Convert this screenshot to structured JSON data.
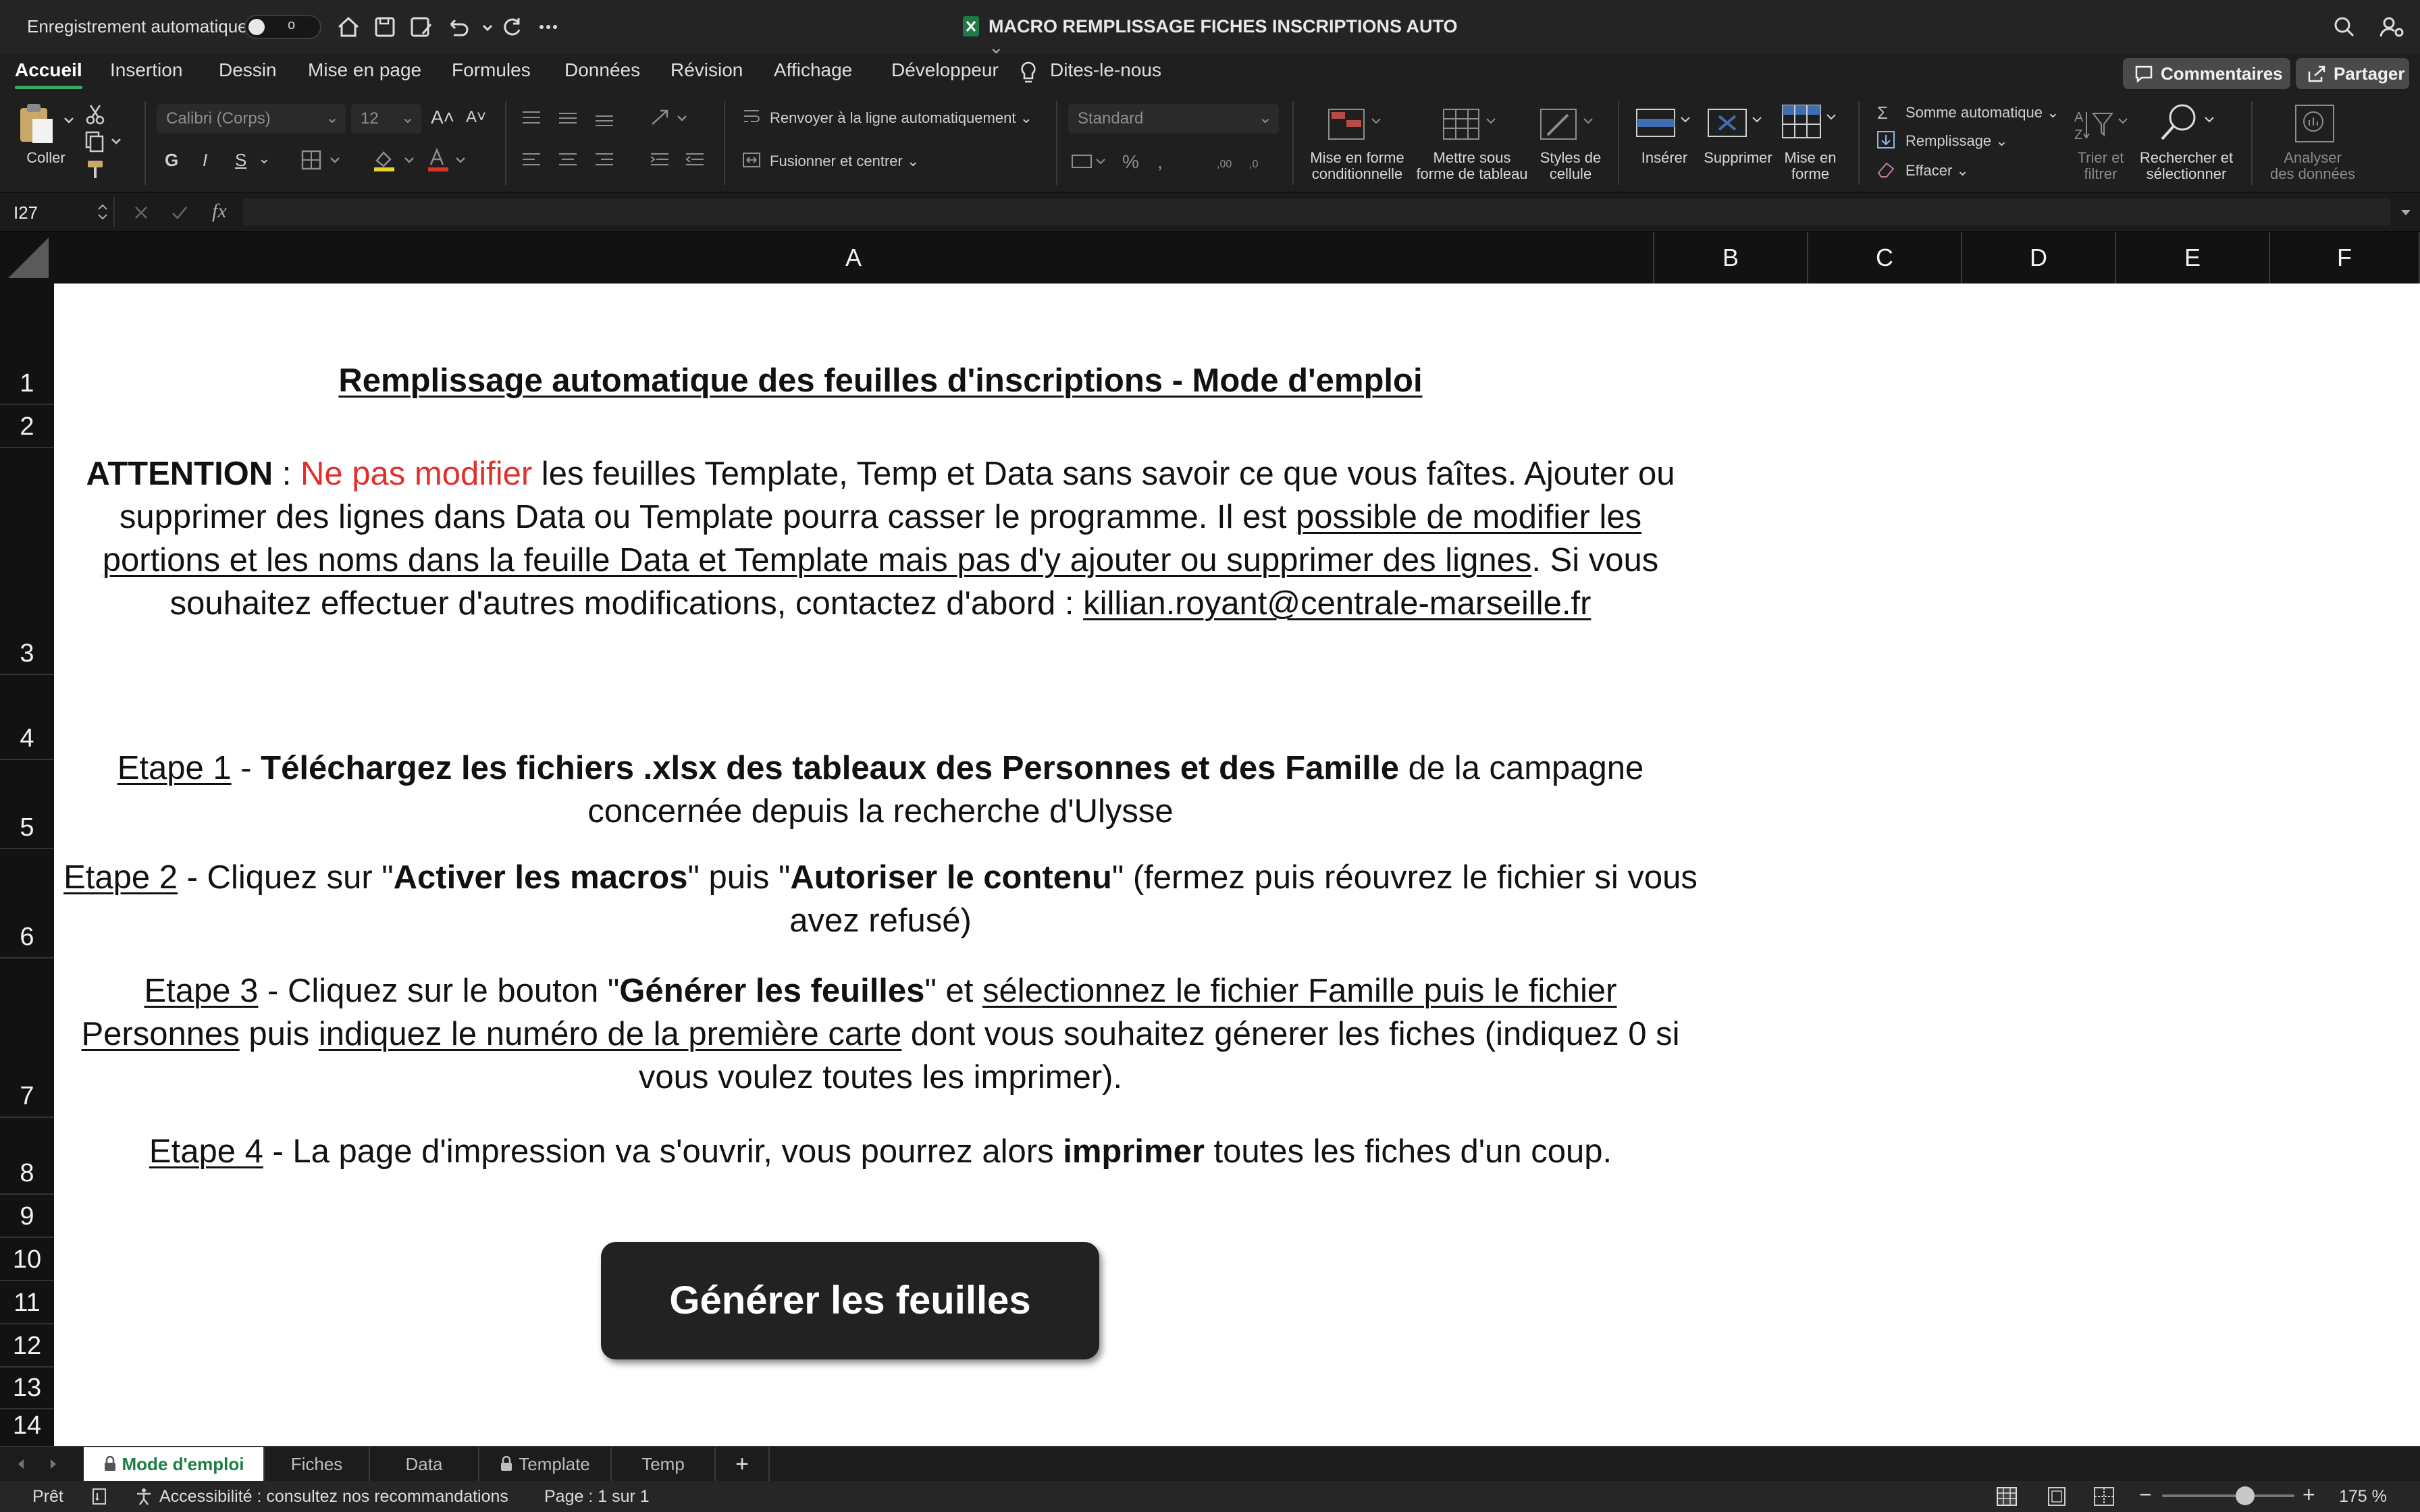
{
  "titlebar": {
    "autosave_label": "Enregistrement automatique",
    "autosave_state": "o",
    "document_title": "MACRO REMPLISSAGE FICHES INSCRIPTIONS AUTO"
  },
  "ribbon_tabs": [
    "Accueil",
    "Insertion",
    "Dessin",
    "Mise en page",
    "Formules",
    "Données",
    "Révision",
    "Affichage",
    "Développeur",
    "Dites-le-nous"
  ],
  "active_tab": "Accueil",
  "buttons": {
    "comments": "Commentaires",
    "share": "Partager"
  },
  "ribbon": {
    "paste": "Coller",
    "font_name": "Calibri (Corps)",
    "font_size": "12",
    "bold": "G",
    "italic": "I",
    "underline": "S",
    "wrap_text": "Renvoyer à la ligne automatiquement",
    "merge_center": "Fusionner et centrer",
    "number_format": "Standard",
    "conditional_format": [
      "Mise en forme",
      "conditionnelle"
    ],
    "format_table": [
      "Mettre sous",
      "forme de tableau"
    ],
    "cell_styles": [
      "Styles de",
      "cellule"
    ],
    "insert": "Insérer",
    "delete": "Supprimer",
    "format": [
      "Mise en",
      "forme"
    ],
    "autosum": "Somme automatique",
    "fill": "Remplissage",
    "clear": "Effacer",
    "sort_filter": [
      "Trier et",
      "filtrer"
    ],
    "find_select": [
      "Rechercher et",
      "sélectionner"
    ],
    "analyze": [
      "Analyser",
      "des données"
    ]
  },
  "formula_bar": {
    "name_box": "I27",
    "fx": "fx",
    "value": ""
  },
  "columns": [
    "A",
    "B",
    "C",
    "D",
    "E",
    "F"
  ],
  "rows": [
    "1",
    "2",
    "3",
    "4",
    "5",
    "6",
    "7",
    "8",
    "9",
    "10",
    "11",
    "12",
    "13",
    "14"
  ],
  "content": {
    "title": "Remplissage automatique des feuilles d'inscriptions - Mode d'emploi",
    "attention": {
      "label": "ATTENTION",
      "sep": " : ",
      "warning": "Ne pas modifier",
      "text1": " les feuilles Template, Temp et Data sans savoir ce que vous faîtes. Ajouter ou supprimer des lignes dans Data ou Template pourra casser le programme. Il est ",
      "link1": "possible de modifier les portions et les noms dans la feuille Data et Template mais pas d'y ajouter ou supprimer des lignes",
      "text2": ". Si vous souhaitez effectuer d'autres modifications, contactez d'abord : ",
      "email": "killian.royant@centrale-marseille.fr"
    },
    "step1": {
      "label": "Etape 1",
      "sep": " - ",
      "bold": "Téléchargez les fichiers .xlsx des tableaux des Personnes et des Famille",
      "text": " de la campagne concernée depuis la recherche d'Ulysse"
    },
    "step2": {
      "label": "Etape 2",
      "t1": " - Cliquez sur \"",
      "b1": "Activer les macros",
      "t2": "\" puis \"",
      "b2": "Autoriser le contenu",
      "t3": "\" (fermez puis réouvrez le fichier si vous avez refusé)"
    },
    "step3": {
      "label": "Etape 3",
      "t1": " - Cliquez sur le bouton \"",
      "b1": "Générer les feuilles",
      "t2": "\" et ",
      "u1": "sélectionnez le fichier Famille puis le fichier Personnes",
      "t3": " puis ",
      "u2": "indiquez le numéro de la première carte",
      "t4": " dont vous souhaitez génerer les fiches (indiquez 0 si vous voulez toutes les imprimer)."
    },
    "step4": {
      "label": "Etape 4",
      "t1": " - La page d'impression va s'ouvrir, vous pourrez alors ",
      "b1": "imprimer",
      "t2": " toutes les fiches d'un coup."
    },
    "generate_button": "Générer les feuilles"
  },
  "sheet_tabs": [
    "Mode d'emploi",
    "Fiches",
    "Data",
    "Template",
    "Temp"
  ],
  "active_sheet": "Mode d'emploi",
  "add_sheet": "+",
  "statusbar": {
    "ready": "Prêt",
    "accessibility": "Accessibilité : consultez nos recommandations",
    "page": "Page : 1 sur 1",
    "zoom": "175 %",
    "zoom_level": 175
  },
  "colors": {
    "accent": "#3aa85f",
    "warning_red": "#e0302c",
    "button_bg": "#222222"
  }
}
